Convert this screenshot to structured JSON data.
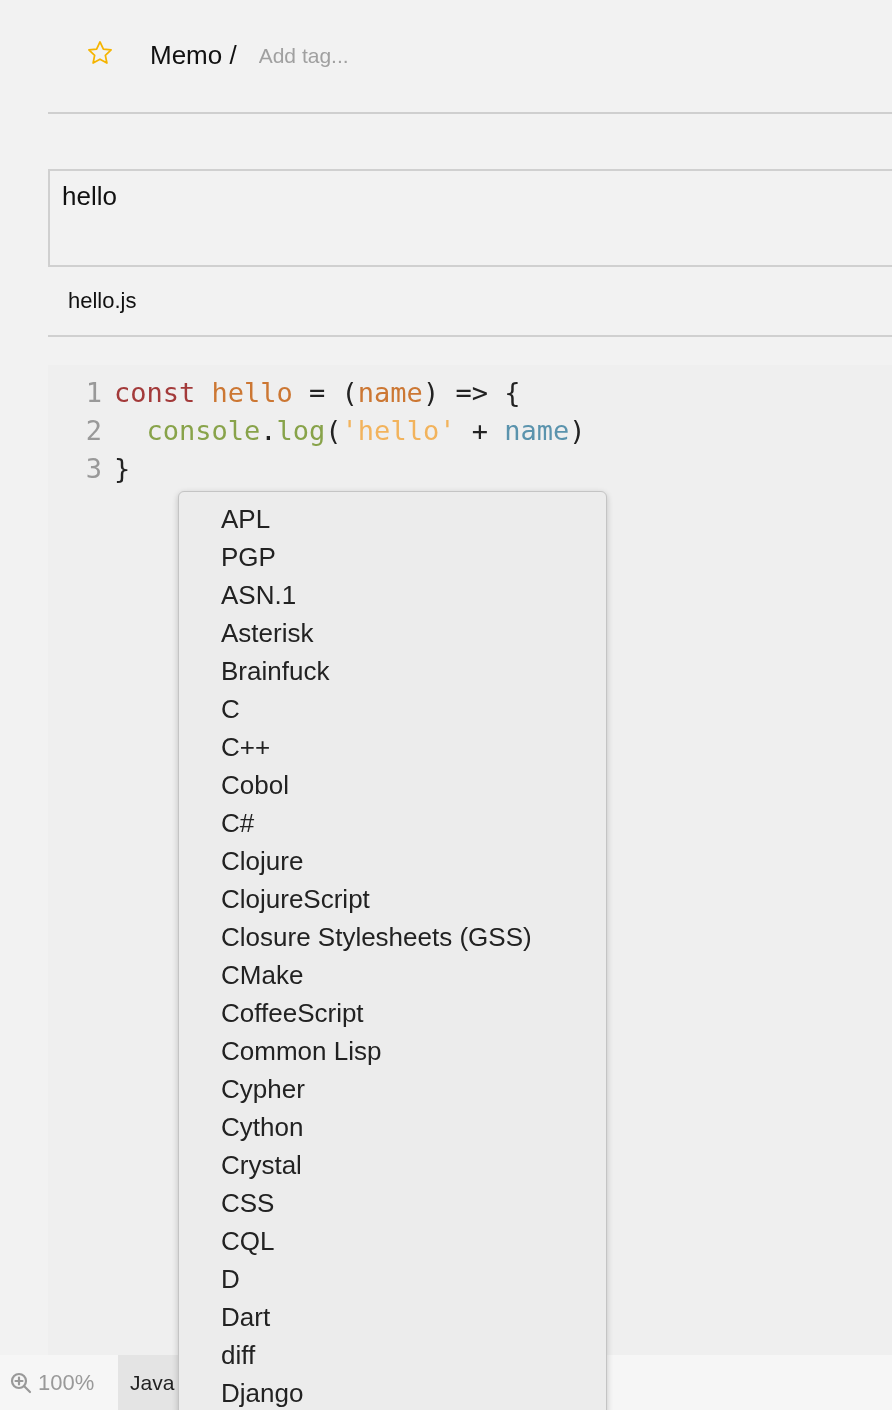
{
  "header": {
    "starred": false,
    "title": "Memo /",
    "tag_field": {
      "placeholder": "Add tag..."
    }
  },
  "description": {
    "value": "hello"
  },
  "file": {
    "name": "hello.js"
  },
  "code": {
    "lines": [
      {
        "number": "1",
        "tokens": [
          {
            "text": "const",
            "kind": "keyword",
            "space_after": true
          },
          {
            "text": "hello",
            "kind": "def"
          },
          {
            "text": " = (",
            "kind": "plain"
          },
          {
            "text": "name",
            "kind": "def"
          },
          {
            "text": ") => {",
            "kind": "plain"
          }
        ]
      },
      {
        "number": "2",
        "indented": true,
        "tokens": [
          {
            "text": "console",
            "kind": "builtin"
          },
          {
            "text": ".",
            "kind": "plain"
          },
          {
            "text": "log",
            "kind": "builtin"
          },
          {
            "text": "(",
            "kind": "plain"
          },
          {
            "text": "'hello'",
            "kind": "string"
          },
          {
            "text": " + ",
            "kind": "plain"
          },
          {
            "text": "name",
            "kind": "variable"
          },
          {
            "text": ")",
            "kind": "plain"
          }
        ]
      },
      {
        "number": "3",
        "tokens": [
          {
            "text": "}",
            "kind": "plain"
          }
        ]
      }
    ]
  },
  "status_bar": {
    "zoom": "100%",
    "mode": "Java"
  },
  "language_menu": {
    "items": [
      {
        "label": "APL",
        "selected": false
      },
      {
        "label": "PGP",
        "selected": false
      },
      {
        "label": "ASN.1",
        "selected": false
      },
      {
        "label": "Asterisk",
        "selected": false
      },
      {
        "label": "Brainfuck",
        "selected": false
      },
      {
        "label": "C",
        "selected": false
      },
      {
        "label": "C++",
        "selected": false
      },
      {
        "label": "Cobol",
        "selected": false
      },
      {
        "label": "C#",
        "selected": false
      },
      {
        "label": "Clojure",
        "selected": false
      },
      {
        "label": "ClojureScript",
        "selected": false
      },
      {
        "label": "Closure Stylesheets (GSS)",
        "selected": false
      },
      {
        "label": "CMake",
        "selected": false
      },
      {
        "label": "CoffeeScript",
        "selected": false
      },
      {
        "label": "Common Lisp",
        "selected": false
      },
      {
        "label": "Cypher",
        "selected": false
      },
      {
        "label": "Cython",
        "selected": false
      },
      {
        "label": "Crystal",
        "selected": false
      },
      {
        "label": "CSS",
        "selected": false
      },
      {
        "label": "CQL",
        "selected": false
      },
      {
        "label": "D",
        "selected": false
      },
      {
        "label": "Dart",
        "selected": false
      },
      {
        "label": "diff",
        "selected": false
      },
      {
        "label": "Django",
        "selected": false
      }
    ]
  }
}
